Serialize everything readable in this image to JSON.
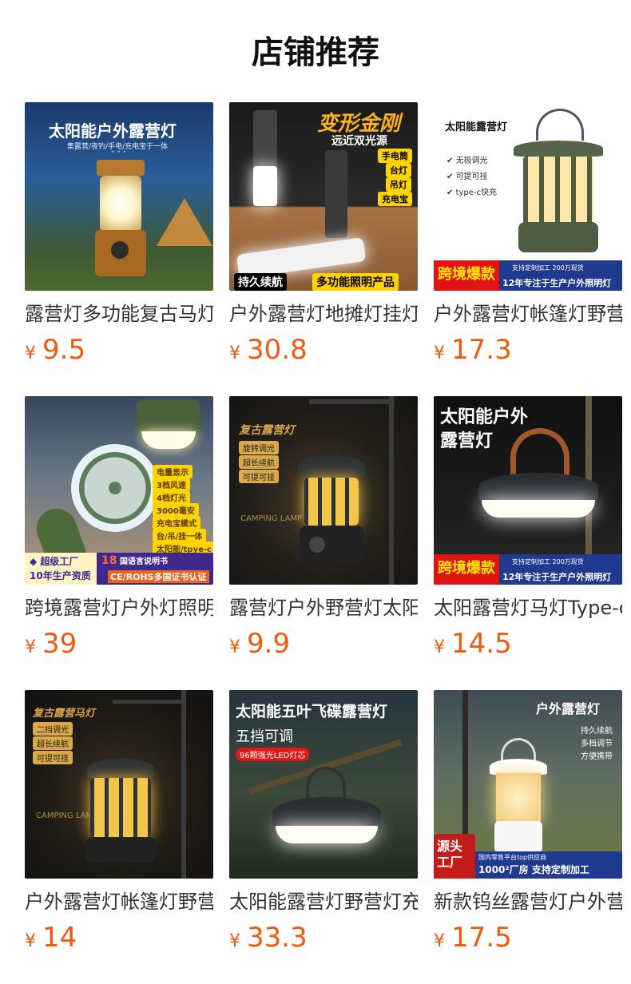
{
  "header": {
    "title": "店铺推荐"
  },
  "currency": "¥",
  "products": [
    {
      "name": "露营灯多功能复古马灯",
      "price": "9.5",
      "image_text": {
        "headline": "太阳能户外露营灯",
        "sub": "集露营/夜钓/手电/充电宝于一体",
        "dots": "• • •"
      }
    },
    {
      "name": "户外露营灯地摊灯挂灯",
      "price": "30.8",
      "image_text": {
        "headline": "变形金刚",
        "sub": "远近双光源",
        "features": [
          "手电筒",
          "台灯",
          "吊灯",
          "充电宝"
        ],
        "left_badge": "持久续航",
        "right_badge": "多功能照明产品"
      }
    },
    {
      "name": "户外露营灯帐篷灯野营",
      "price": "17.3",
      "image_text": {
        "headline": "太阳能露营灯",
        "features": [
          "无极调光",
          "可提可挂",
          "type-c快充"
        ],
        "promo": "跨境爆款",
        "promo_top": "支持定制加工  200万现货",
        "promo_bottom": "12年专注于生产户外照明灯"
      }
    },
    {
      "name": "跨境露营灯户外灯照明",
      "price": "39",
      "image_text": {
        "features": [
          "电量显示",
          "3档风速",
          "4档灯光",
          "3000毫安",
          "充电宝模式",
          "台/吊/挂一体",
          "太阳能/tpye-c"
        ],
        "factory": "超级工厂",
        "years": "10年生产资质",
        "lang_badge_num": "18",
        "lang_badge": "国语言说明书",
        "cert": "CE/ROHS多国证书认证"
      }
    },
    {
      "name": "露营灯户外野营灯太阳能",
      "price": "9.9",
      "image_text": {
        "headline": "复古露营灯",
        "features": [
          "旋转调光",
          "超长续航",
          "可提可挂"
        ],
        "brand": "CAMPING LAMP"
      }
    },
    {
      "name": "太阳露营灯马灯Type-c",
      "price": "14.5",
      "image_text": {
        "headline_1": "太阳能户外",
        "headline_2": "露营灯",
        "promo": "跨境爆款",
        "promo_top": "支持定制加工  200万现货",
        "promo_bottom": "12年专注于生产户外照明灯"
      }
    },
    {
      "name": "户外露营灯帐篷灯野营",
      "price": "14",
      "image_text": {
        "headline": "复古露营马灯",
        "features": [
          "二挡调光",
          "超长续航",
          "可提可挂"
        ],
        "brand": "CAMPING LAMP"
      }
    },
    {
      "name": "太阳能露营灯野营灯充电",
      "price": "33.3",
      "image_text": {
        "headline": "太阳能五叶飞碟露营灯",
        "sub": "五挡可调",
        "chip": "96颗强光LED灯芯"
      }
    },
    {
      "name": "新款钨丝露营灯户外营地",
      "price": "17.5",
      "image_text": {
        "headline": "户外露营灯",
        "features": [
          "持久续航",
          "多档调节",
          "方便携带"
        ],
        "source_1": "源头",
        "source_2": "工厂",
        "sub_badge": "国内零售平台top供应商",
        "factory": "1000²厂房  支持定制加工"
      }
    }
  ],
  "colors": {
    "accent": "#ee5a10",
    "title": "#111111",
    "name": "#333333"
  }
}
